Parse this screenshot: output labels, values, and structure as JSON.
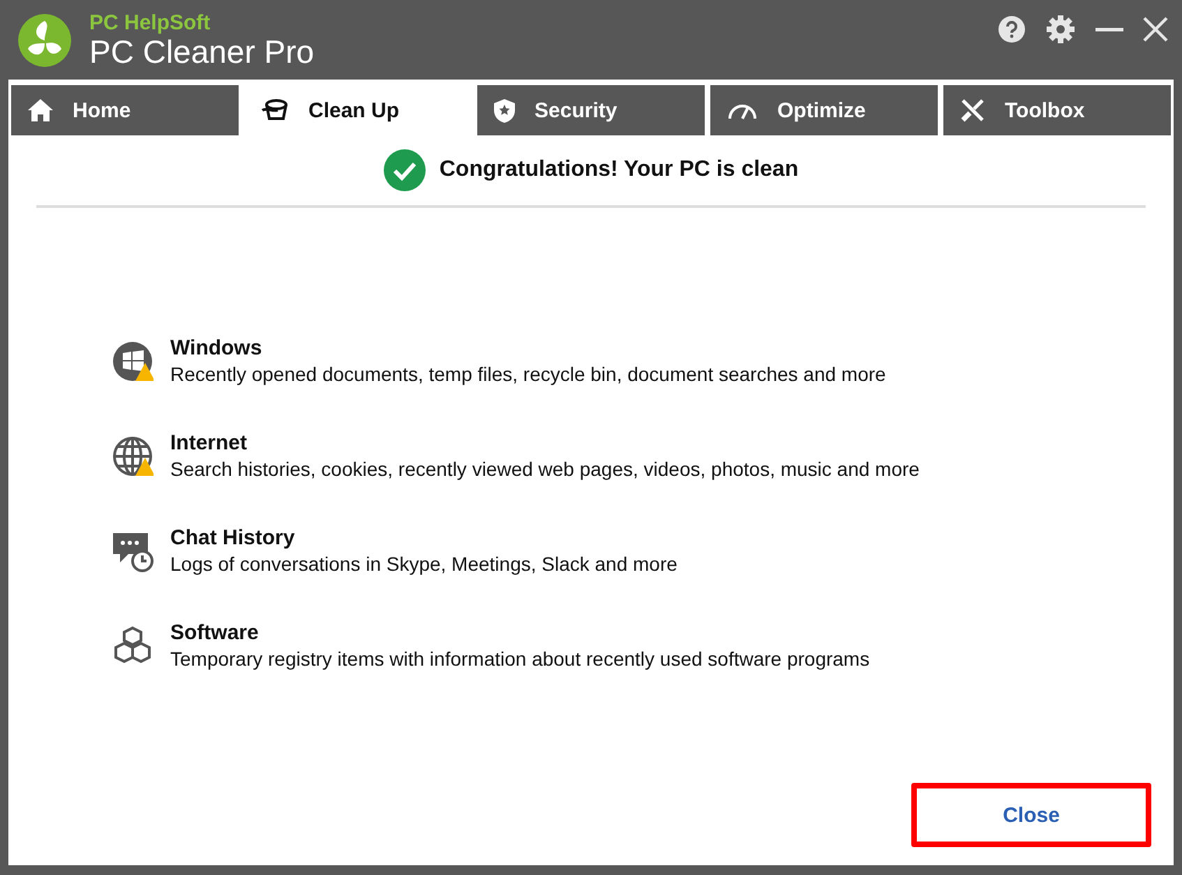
{
  "app": {
    "brand": "PC HelpSoft",
    "title": "PC Cleaner Pro"
  },
  "tabs": [
    {
      "label": "Home",
      "kind": "home",
      "selected": false
    },
    {
      "label": "Clean Up",
      "kind": "cleanup",
      "selected": true
    },
    {
      "label": "Security",
      "kind": "security",
      "selected": false
    },
    {
      "label": "Optimize",
      "kind": "optimize",
      "selected": false
    },
    {
      "label": "Toolbox",
      "kind": "toolbox",
      "selected": false
    }
  ],
  "status": {
    "message": "Congratulations! Your PC is clean"
  },
  "categories": [
    {
      "kind": "windows",
      "title": "Windows",
      "description": "Recently opened documents, temp files, recycle bin, document searches and more",
      "warning": true
    },
    {
      "kind": "internet",
      "title": "Internet",
      "description": "Search histories, cookies, recently viewed web pages, videos, photos, music and more",
      "warning": true
    },
    {
      "kind": "chat",
      "title": "Chat History",
      "description": "Logs of conversations in Skype, Meetings, Slack and more",
      "warning": false
    },
    {
      "kind": "software",
      "title": "Software",
      "description": "Temporary registry items with information about recently used software programs",
      "warning": false
    }
  ],
  "close_button": {
    "label": "Close",
    "highlighted": true
  }
}
